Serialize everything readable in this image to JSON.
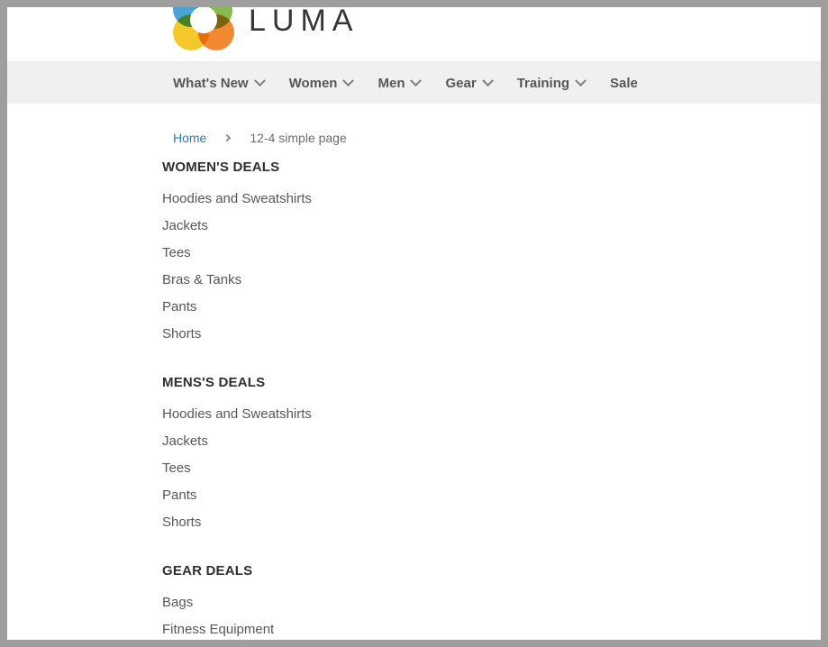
{
  "brand": {
    "wordmark": "LUMA",
    "logo_icon": "luma-flower-logo",
    "colors": {
      "blue": "#3a9bd4",
      "green": "#7cb342",
      "orange": "#ef7f1f",
      "yellow": "#f5c518"
    }
  },
  "nav": {
    "items": [
      {
        "label": "What's New",
        "has_dropdown": true
      },
      {
        "label": "Women",
        "has_dropdown": true
      },
      {
        "label": "Men",
        "has_dropdown": true
      },
      {
        "label": "Gear",
        "has_dropdown": true
      },
      {
        "label": "Training",
        "has_dropdown": true
      },
      {
        "label": "Sale",
        "has_dropdown": false
      }
    ]
  },
  "breadcrumb": {
    "home_label": "Home",
    "separator": "chevron-right-icon",
    "current_label": "12-4 simple page"
  },
  "content": {
    "groups": [
      {
        "heading": "WOMEN'S DEALS",
        "links": [
          "Hoodies and Sweatshirts",
          "Jackets",
          "Tees",
          "Bras & Tanks",
          "Pants",
          "Shorts"
        ]
      },
      {
        "heading": "MENS'S DEALS",
        "links": [
          "Hoodies and Sweatshirts",
          "Jackets",
          "Tees",
          "Pants",
          "Shorts"
        ]
      },
      {
        "heading": "GEAR DEALS",
        "links": [
          "Bags",
          "Fitness Equipment"
        ]
      }
    ]
  },
  "theme": {
    "link_blue": "#2b7bbd",
    "nav_bg": "#f0f0f0",
    "text_gray": "#575757",
    "heading_dark": "#2f2f2f",
    "frame_gray": "#9e9e9e"
  }
}
